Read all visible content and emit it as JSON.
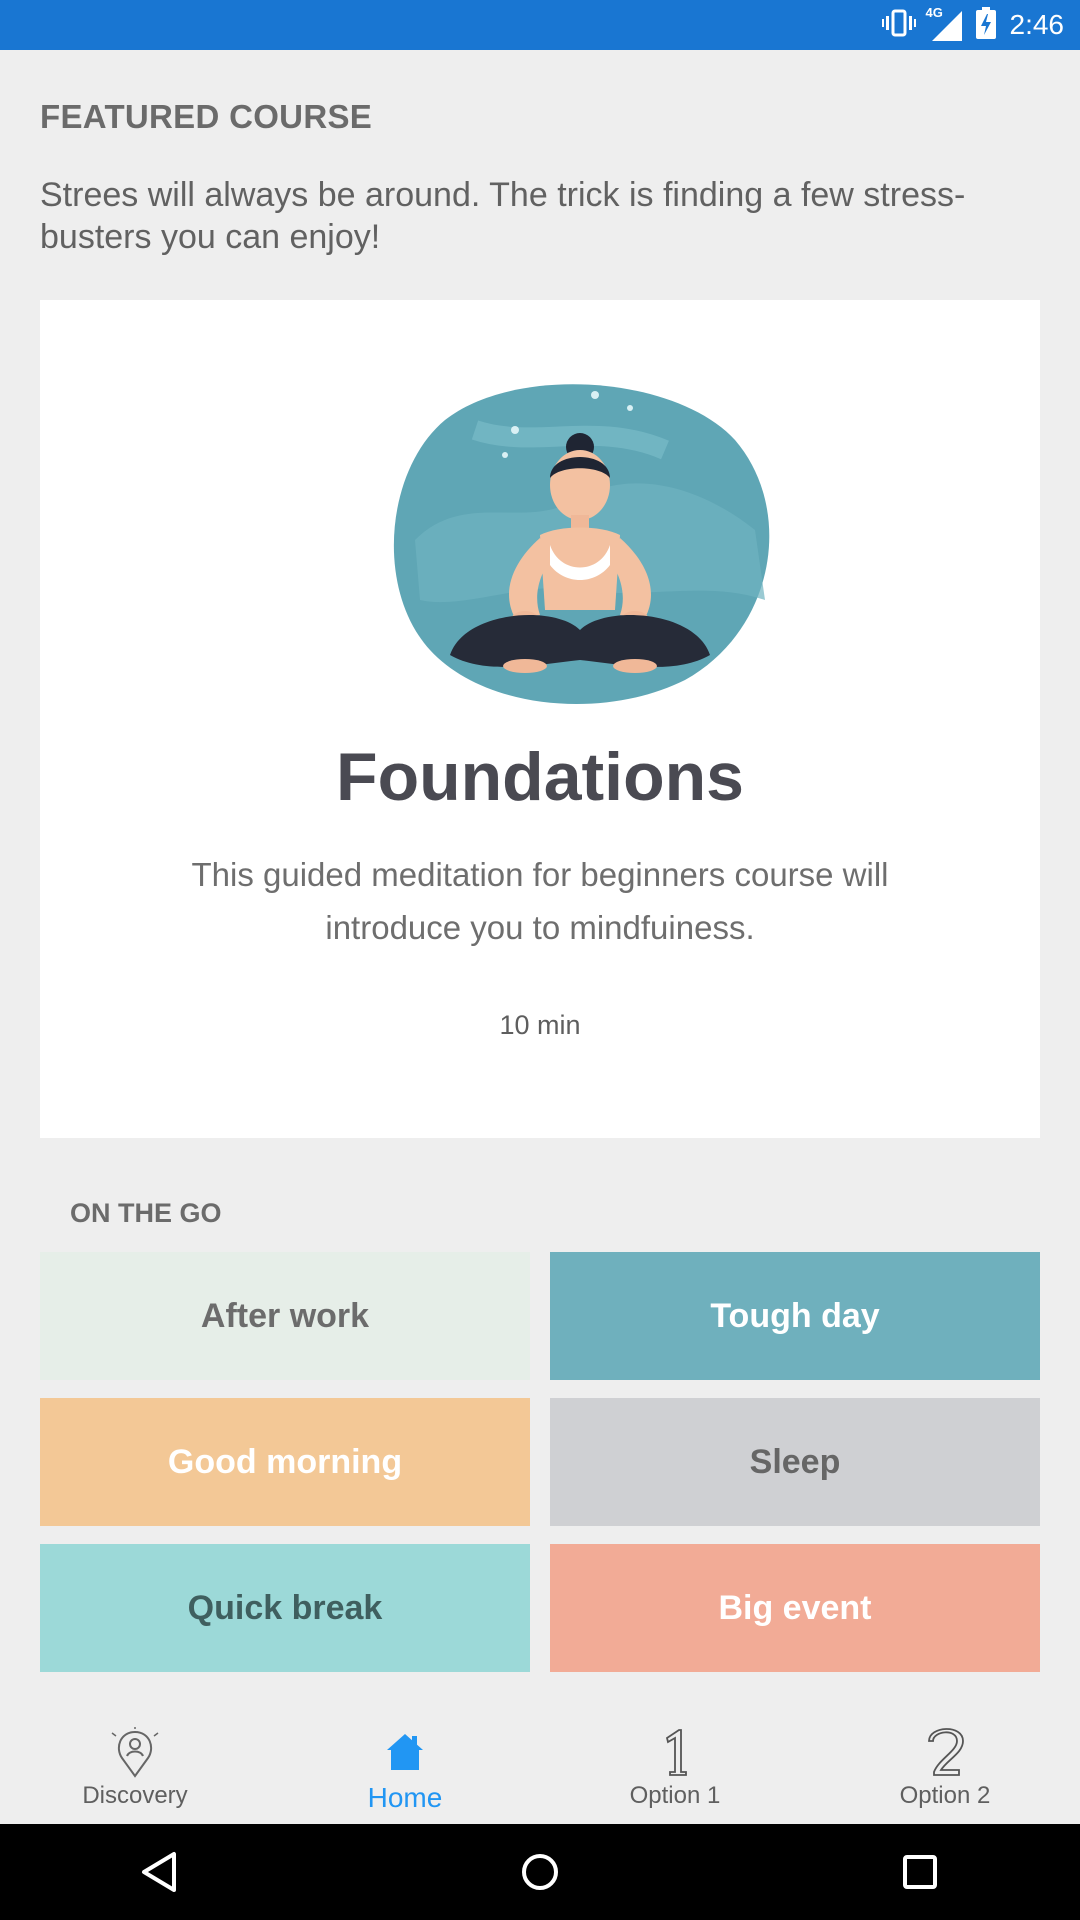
{
  "status_bar": {
    "time": "2:46",
    "network_label": "4G",
    "icons": [
      "vibrate-icon",
      "signal-icon",
      "battery-charging-icon"
    ],
    "color": "#1976d2"
  },
  "featured": {
    "section_title": "FEATURED COURSE",
    "intro_text": "Strees will always be around. The trick is finding a few stress-busters you can enjoy!",
    "card": {
      "image": "meditation-illustration",
      "title": "Foundations",
      "description": "This guided meditation for beginners course will introduce you to mindfuiness.",
      "duration": "10 min"
    }
  },
  "on_the_go": {
    "title": "ON THE GO",
    "tiles": [
      {
        "label": "After work",
        "bg": "#e6eee8",
        "fg": "#6c6c6c"
      },
      {
        "label": "Tough day",
        "bg": "#6fb0bd",
        "fg": "#ffffff"
      },
      {
        "label": "Good morning",
        "bg": "#f3c896",
        "fg": "#ffffff"
      },
      {
        "label": "Sleep",
        "bg": "#cfd0d3",
        "fg": "#666666"
      },
      {
        "label": "Quick break",
        "bg": "#9cd9d8",
        "fg": "#3f5f5f"
      },
      {
        "label": "Big event",
        "bg": "#f2ab96",
        "fg": "#ffffff"
      }
    ]
  },
  "bottom_nav": {
    "items": [
      {
        "label": "Discovery",
        "icon": "location-pin-person-icon",
        "active": false
      },
      {
        "label": "Home",
        "icon": "home-icon",
        "active": true
      },
      {
        "label": "Option 1",
        "icon": "number-one-icon",
        "active": false
      },
      {
        "label": "Option 2",
        "icon": "number-two-icon",
        "active": false
      }
    ],
    "active_color": "#2196f3"
  },
  "system_nav": {
    "icons": [
      "back-icon",
      "home-circle-icon",
      "recents-icon"
    ]
  }
}
